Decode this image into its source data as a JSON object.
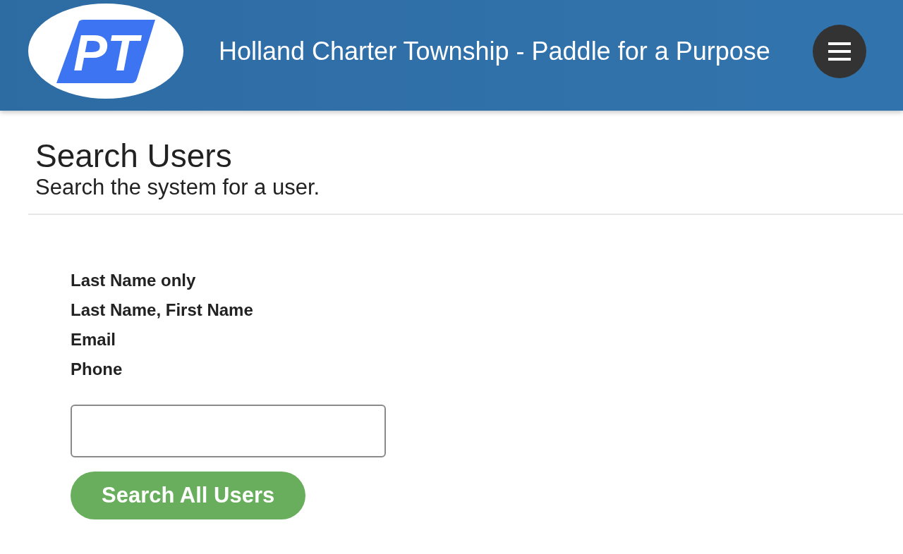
{
  "header": {
    "logo": {
      "text": "PT"
    },
    "title": "Holland Charter Township - Paddle for a Purpose"
  },
  "page": {
    "title": "Search Users",
    "subtitle": "Search the system for a user."
  },
  "search_form": {
    "hints": [
      "Last Name only",
      "Last Name, First Name",
      "Email",
      "Phone"
    ],
    "button": "Search All Users"
  }
}
